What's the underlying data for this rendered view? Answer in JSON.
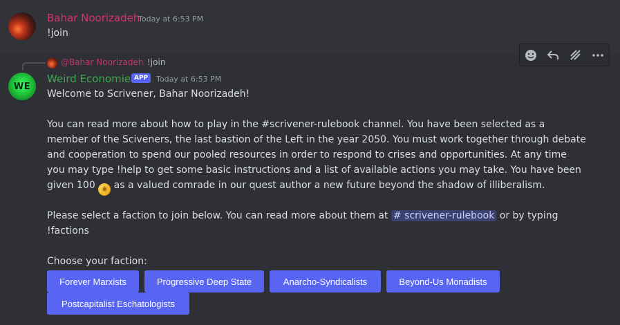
{
  "messages": [
    {
      "username": "Bahar Noorizadeh",
      "timestamp": "Today at 6:53 PM",
      "text": "!join"
    }
  ],
  "reply": {
    "mention": "@Bahar Noorizadeh",
    "text": "!join"
  },
  "bot_message": {
    "avatar_initials": "WE",
    "username": "Weird Economies",
    "badge": "APP",
    "timestamp": "Today at 6:53 PM",
    "welcome": "Welcome to Scrivener, Bahar Noorizadeh!",
    "para1_a": "You can read more about how to play in the #scrivener-rulebook channel. You have been selected as a member of the Sciveners, the last bastion of the Left in the year 2050. You must work together through debate and cooperation to spend our pooled resources in order to respond to crises and opportunities. At any time you may type !help to get some basic instructions and a list of available actions you may take. You have been given 100 ",
    "para1_b": " as a valued comrade in our quest author a new future beyond the shadow of illiberalism.",
    "para2_a": "Please select a faction to join below. You can read more about them at ",
    "channel_mention": "# scrivener-rulebook",
    "para2_b": " or by typing !factions",
    "choose": "Choose your faction:",
    "buttons": [
      "Forever Marxists",
      "Progressive Deep State",
      "Anarcho-Syndicalists",
      "Beyond-Us Monadists",
      "Postcapitalist Eschatologists"
    ]
  },
  "toolbar": {
    "icons": [
      "add-reaction-icon",
      "reply-icon",
      "thread-icon",
      "more-icon"
    ]
  },
  "colors": {
    "background": "#313338",
    "accent": "#5865f2",
    "username1": "#d6336c",
    "username2": "#3ea84f"
  }
}
